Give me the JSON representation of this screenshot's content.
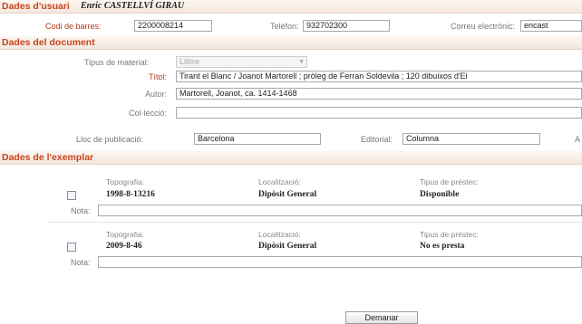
{
  "user_section": {
    "title": "Dades d'usuari",
    "name": "Enric CASTELLVÍ GIRAU",
    "barcode_label": "Codi de barres:",
    "barcode_value": "2200008214",
    "phone_label": "Telèfon:",
    "phone_value": "932702300",
    "email_label": "Correu electrònic:",
    "email_value": "encast"
  },
  "document_section": {
    "title": "Dades del document",
    "material_label": "Tipus de material:",
    "material_value": "Llibre",
    "title_label": "Títol:",
    "title_value": "Tirant el Blanc / Joanot Martorell ; pròleg de Ferran Soldevila ; 120 dibuixos d'Ei",
    "author_label": "Autor:",
    "author_value": "Martorell, Joanot, ca. 1414-1468",
    "collection_label": "Col·lecció:",
    "collection_value": "",
    "place_label": "Lloc de publicació:",
    "place_value": "Barcelona",
    "publisher_label": "Editorial:",
    "publisher_value": "Columna",
    "year_label": "A"
  },
  "copies_section": {
    "title": "Dades de l'exemplar",
    "topography_header": "Topografia:",
    "location_header": "Localització:",
    "loan_type_header": "Tipus de préstec:",
    "note_label": "Nota:",
    "copies": [
      {
        "topography": "1998-8-13216",
        "location": "Dipòsit General",
        "loan_type": "Disponible",
        "note": ""
      },
      {
        "topography": "2009-8-46",
        "location": "Dipòsit General",
        "loan_type": "No es presta",
        "note": ""
      }
    ]
  },
  "actions": {
    "request_label": "Demanar"
  },
  "colors": {
    "section_title": "#c8461d",
    "label_red": "#b4391b"
  }
}
